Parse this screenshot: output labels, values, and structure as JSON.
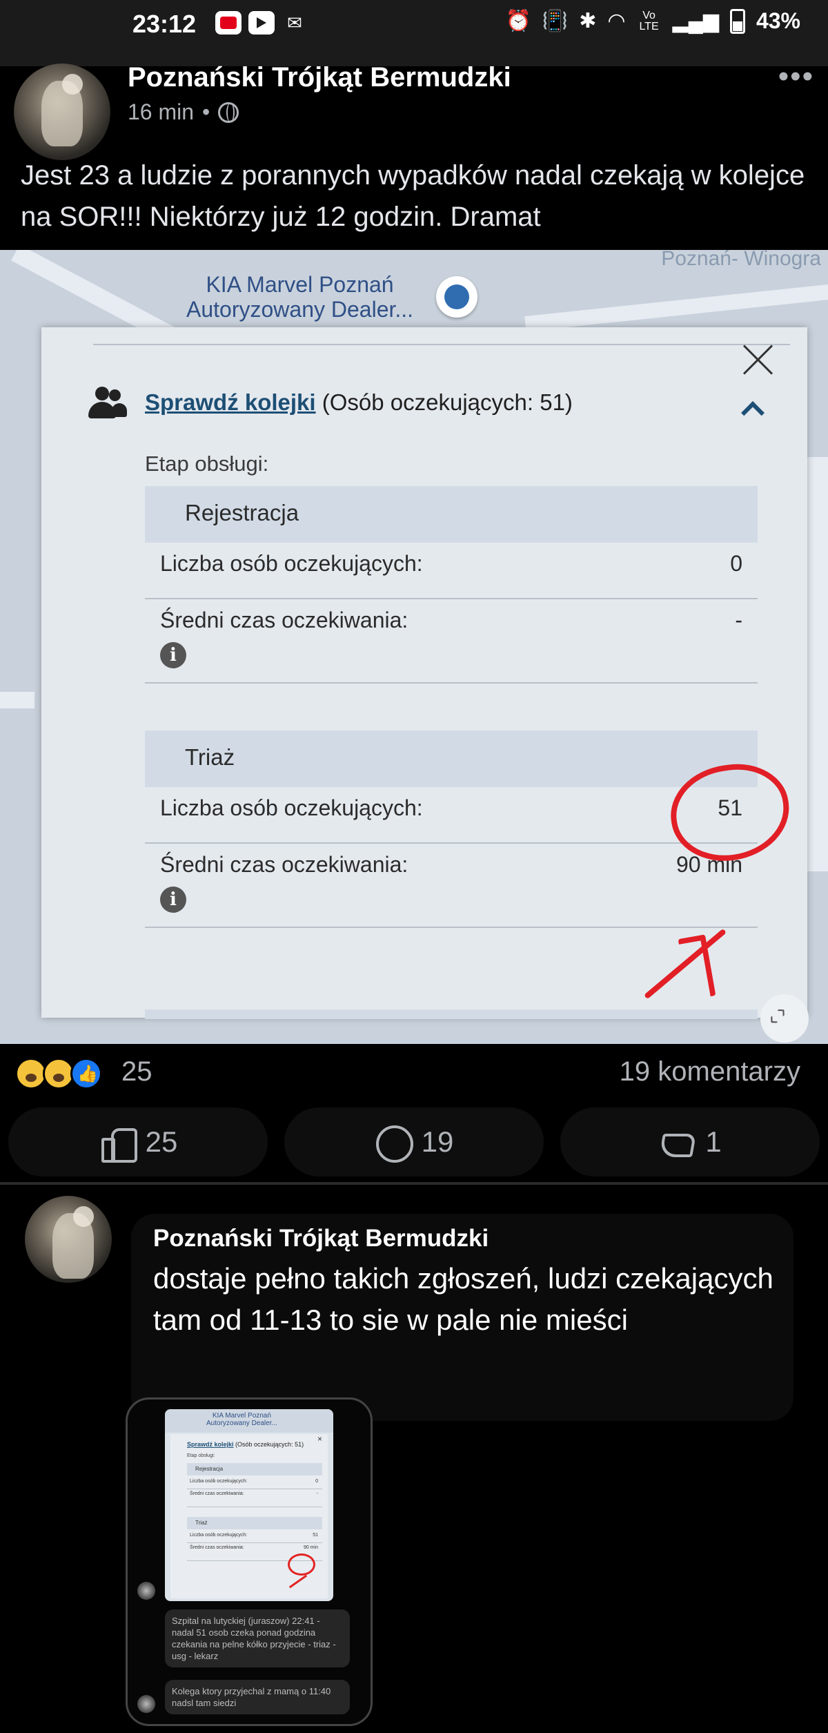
{
  "status_bar": {
    "time": "23:12",
    "battery": "43%",
    "icons": [
      "youtube-icon",
      "youtube-icon",
      "gmail-icon",
      "alarm-icon",
      "vibrate-icon",
      "bluetooth-icon",
      "wifi-icon",
      "volte-icon",
      "signal-icon",
      "battery-icon"
    ],
    "volte_label": "Vo LTE"
  },
  "post": {
    "page_name": "Poznański Trójkąt Bermudzki",
    "time_ago": "16 min",
    "separator": "•",
    "text": "Jest 23 a ludzie z porannych wypadków nadal czekają w kolejce na SOR!!! Niektórzy już 12 godzin. Dramat"
  },
  "screenshot": {
    "map": {
      "dealer_label": "KIA Marvel Poznań\nAutoryzowany Dealer...",
      "corner_label": "Poznań- Winogra"
    },
    "queue_link": "Sprawdź kolejki",
    "queue_count_text": " (Osób oczekujących: 51)",
    "stage_label": "Etap obsługi:",
    "stages": [
      {
        "name": "Rejestracja",
        "waiting_label": "Liczba osób oczekujących:",
        "waiting_value": "0",
        "avg_label": "Średni czas oczekiwania:",
        "avg_value": "-"
      },
      {
        "name": "Triaż",
        "waiting_label": "Liczba osób oczekujących:",
        "waiting_value": "51",
        "avg_label": "Średni czas oczekiwania:",
        "avg_value": "90 min"
      }
    ],
    "info_glyph": "i",
    "annotation_color": "#e21f26"
  },
  "reactions": {
    "count": "25",
    "comments": "19 komentarzy",
    "like_count": "25",
    "comment_count": "19",
    "share_count": "1"
  },
  "comment": {
    "author": "Poznański Trójkąt Bermudzki",
    "text": "dostaje pełno takich zgłoszeń, ludzi czekających tam od 11-13 to sie w pale nie mieści",
    "attachment": {
      "mini_map_text": "KIA Marvel Poznań\nAutoryzowany Dealer...",
      "mini_head_link": "Sprawdź kolejki",
      "mini_head_rest": " (Osób oczekujących: 51)",
      "mini_stage": "Etap obsługi:",
      "mini_reg": "Rejestracja",
      "mini_triaz": "Triaż",
      "mini_waiting": "Liczba osób oczekujących:",
      "mini_avg": "Średni czas oczekiwania:",
      "mini_val0": "0",
      "mini_dash": "-",
      "mini_val51": "51",
      "mini_90": "90 min",
      "message1": "Szpital na lutyckiej (juraszow) 22:41 - nadal 51 osob czeka ponad godzina czekania na pelne kółko przyjecie - triaz - usg - lekarz",
      "message2": "Kolega ktory przyjechal z mamą o 11:40 nadsl tam siedzi"
    }
  }
}
